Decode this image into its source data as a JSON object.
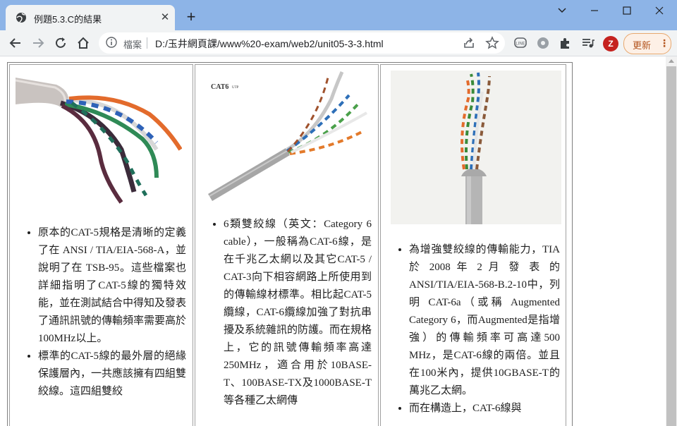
{
  "tab": {
    "title": "例題5.3.C的結果",
    "close_glyph": "✕",
    "newtab_glyph": "+"
  },
  "window": {
    "minimize_glyph": "—",
    "maximize_glyph": "☐",
    "close_glyph": "✕"
  },
  "toolbar": {
    "back_glyph": "←",
    "forward_glyph": "→",
    "reload_glyph": "↻",
    "home_glyph": "⌂",
    "omnibox_label": "檔案",
    "url": "D:/玉井網頁課/www%20-exam/web2/unit05-3-3.html",
    "avatar_letter": "Z",
    "update_label": "更新",
    "update_dots": "⋮",
    "accent_color": "#c5221f"
  },
  "icons": {
    "tab_favicon": "globe-icon",
    "omnibox_info": "info-icon",
    "share": "share-icon",
    "bookmark": "star-icon",
    "extensions": [
      "line-icon",
      "settings-extension-icon",
      "puzzle-icon",
      "media-queue-icon"
    ]
  },
  "cells": [
    {
      "image_label": "",
      "items": [
        "原本的CAT-5規格是清晰的定義了在 ANSI / TIA/EIA-568-A，並說明了在 TSB-95。這些檔案也詳細指明了CAT-5線的獨特效能，並在測試結合中得知及發表了通訊訊號的傳輸頻率需要高於100MHz以上。",
        "標準的CAT-5線的最外層的絕緣保護層內，一共應該擁有四組雙絞線。這四組雙絞"
      ]
    },
    {
      "image_label": "CAT6",
      "image_sublabel": "UTP",
      "items": [
        "6類雙絞線（英文：Category 6 cable），一般稱為CAT-6線，是在千兆乙太網以及其它CAT-5 / CAT-3向下相容網路上所使用到的傳輸線材標準。相比起CAT-5纜線，CAT-6纜線加強了對抗串擾及系統雜訊的防護。而在規格上，它的訊號傳輸頻率高達 250MHz，適合用於10BASE-T、100BASE-TX及1000BASE-T等各種乙太網傳"
      ]
    },
    {
      "image_label": "",
      "items": [
        "為增強雙絞線的傳輸能力，TIA 於 2008 年 2 月 發 表 的ANSI/TIA/EIA-568-B.2-10中，列明 CAT-6a（或稱 Augmented Category 6，而Augmented是指增強）的傳輸頻率可高達500 MHz，是CAT-6線的兩倍。並且在100米內，提供10GBASE-T的萬兆乙太網。",
        "而在構造上，CAT-6線與"
      ]
    }
  ]
}
